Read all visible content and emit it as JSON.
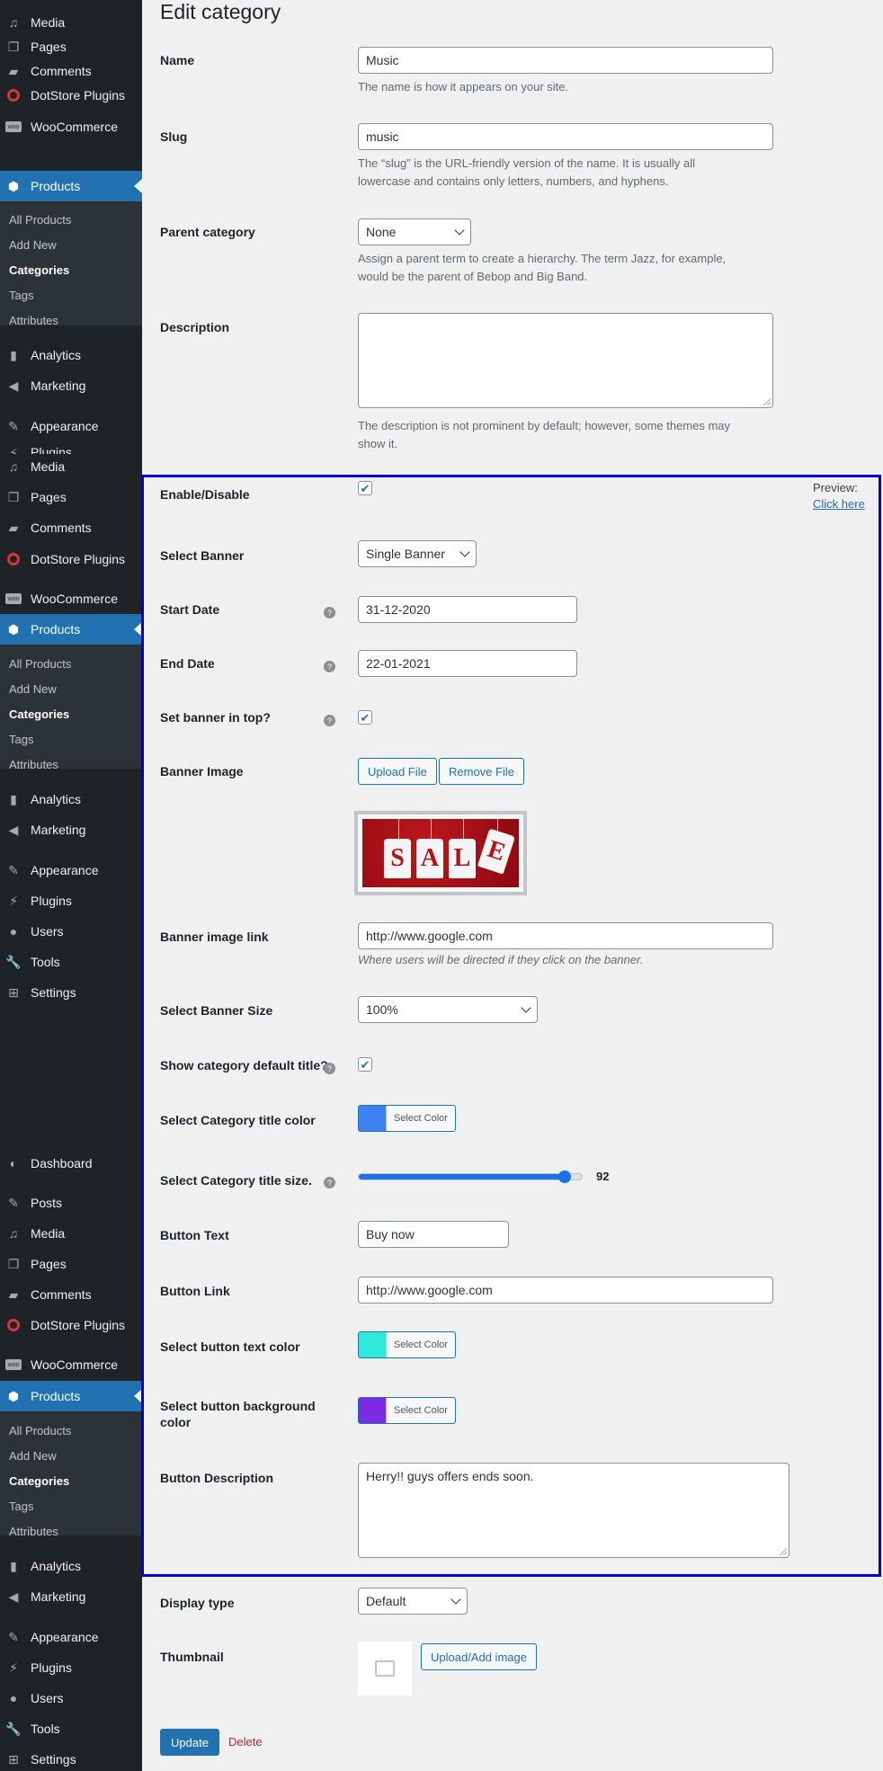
{
  "sidebar": {
    "blocks": [
      {
        "items_top": [
          {
            "label": "Media",
            "icon": "media-icon"
          },
          {
            "label": "Pages",
            "icon": "pages-icon"
          },
          {
            "label": "Comments",
            "icon": "comments-icon"
          },
          {
            "label": "DotStore Plugins",
            "icon": "dotstore-icon"
          },
          {
            "label": "WooCommerce",
            "icon": "woocommerce-icon"
          },
          {
            "label": "Products",
            "icon": "products-icon"
          }
        ],
        "sub": [
          "All Products",
          "Add New",
          "Categories",
          "Tags",
          "Attributes"
        ],
        "items_bottom": [
          {
            "label": "Analytics",
            "icon": "analytics-icon"
          },
          {
            "label": "Marketing",
            "icon": "marketing-icon"
          },
          {
            "label": "Appearance",
            "icon": "appearance-icon"
          },
          {
            "label": "Plugins",
            "icon": "plugins-icon"
          }
        ]
      },
      {
        "items_top": [
          {
            "label": "Media"
          },
          {
            "label": "Pages"
          },
          {
            "label": "Comments"
          },
          {
            "label": "DotStore Plugins"
          },
          {
            "label": "WooCommerce"
          },
          {
            "label": "Products"
          }
        ],
        "sub": [
          "All Products",
          "Add New",
          "Categories",
          "Tags",
          "Attributes"
        ],
        "items_bottom": [
          {
            "label": "Analytics"
          },
          {
            "label": "Marketing"
          },
          {
            "label": "Appearance"
          },
          {
            "label": "Plugins"
          },
          {
            "label": "Users"
          },
          {
            "label": "Tools"
          },
          {
            "label": "Settings"
          }
        ]
      },
      {
        "items_top": [
          {
            "label": "Dashboard"
          },
          {
            "label": "Posts"
          },
          {
            "label": "Media"
          },
          {
            "label": "Pages"
          },
          {
            "label": "Comments"
          },
          {
            "label": "DotStore Plugins"
          },
          {
            "label": "WooCommerce"
          },
          {
            "label": "Products"
          }
        ],
        "sub": [
          "All Products",
          "Add New",
          "Categories",
          "Tags",
          "Attributes"
        ],
        "items_bottom": [
          {
            "label": "Analytics"
          },
          {
            "label": "Marketing"
          },
          {
            "label": "Appearance"
          },
          {
            "label": "Plugins"
          },
          {
            "label": "Users"
          },
          {
            "label": "Tools"
          },
          {
            "label": "Settings"
          }
        ]
      }
    ]
  },
  "page": {
    "title": "Edit category"
  },
  "form": {
    "name": {
      "label": "Name",
      "value": "Music",
      "desc": "The name is how it appears on your site."
    },
    "slug": {
      "label": "Slug",
      "value": "music",
      "desc1": "The “slug” is the URL-friendly version of the name. It is usually all",
      "desc2": "lowercase and contains only letters, numbers, and hyphens."
    },
    "parent": {
      "label": "Parent category",
      "value": "None",
      "desc1": "Assign a parent term to create a hierarchy. The term Jazz, for example,",
      "desc2": "would be the parent of Bebop and Big Band."
    },
    "description": {
      "label": "Description",
      "value": "",
      "desc1": "The description is not prominent by default; however, some themes may",
      "desc2": "show it."
    }
  },
  "banner": {
    "enable_label": "Enable/Disable",
    "preview_label": "Preview:",
    "preview_link": "Click here",
    "select_banner_label": "Select Banner",
    "select_banner_value": "Single Banner",
    "start_date_label": "Start Date",
    "start_date_value": "31-12-2020",
    "end_date_label": "End Date",
    "end_date_value": "22-01-2021",
    "top_label": "Set banner in top?",
    "image_label": "Banner Image",
    "upload_btn": "Upload File",
    "remove_btn": "Remove File",
    "sale_letters": [
      "S",
      "A",
      "L",
      "E"
    ],
    "link_label": "Banner image link",
    "link_value": "http://www.google.com",
    "link_desc": "Where users will be directed if they click on the banner.",
    "size_label": "Select Banner Size",
    "size_value": "100%",
    "show_title_label": "Show category default title?",
    "title_color_label": "Select Category title color",
    "title_color": "#3b82f0",
    "select_color_text": "Select Color",
    "title_size_label": "Select Category title size.",
    "title_size_value": "92",
    "title_size_fraction": 0.92,
    "button_text_label": "Button Text",
    "button_text_value": "Buy now",
    "button_link_label": "Button Link",
    "button_link_value": "http://www.google.com",
    "btn_text_color_label": "Select button text color",
    "btn_text_color": "#2ee8dc",
    "btn_bg_color_label1": "Select button background",
    "btn_bg_color_label2": "color",
    "btn_bg_color": "#7b2be2",
    "button_desc_label": "Button Description",
    "button_desc_value": "Herry!! guys offers ends soon."
  },
  "display": {
    "label": "Display type",
    "value": "Default"
  },
  "thumbnail": {
    "label": "Thumbnail",
    "button": "Upload/Add image"
  },
  "actions": {
    "update": "Update",
    "delete": "Delete"
  }
}
